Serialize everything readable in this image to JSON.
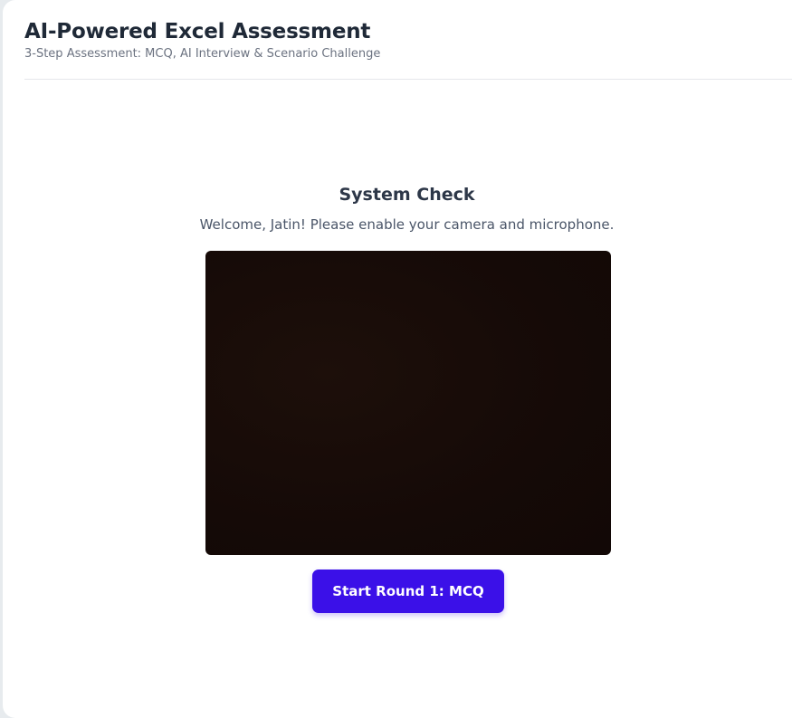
{
  "header": {
    "title": "AI-Powered Excel Assessment",
    "subtitle": "3-Step Assessment: MCQ, AI Interview & Scenario Challenge"
  },
  "system_check": {
    "title": "System Check",
    "welcome": "Welcome, Jatin! Please enable your camera and microphone."
  },
  "actions": {
    "start_label": "Start Round 1: MCQ"
  },
  "colors": {
    "accent": "#3b10e8",
    "title": "#1f2937",
    "muted": "#6b7280",
    "video_bg": "#160b07"
  }
}
